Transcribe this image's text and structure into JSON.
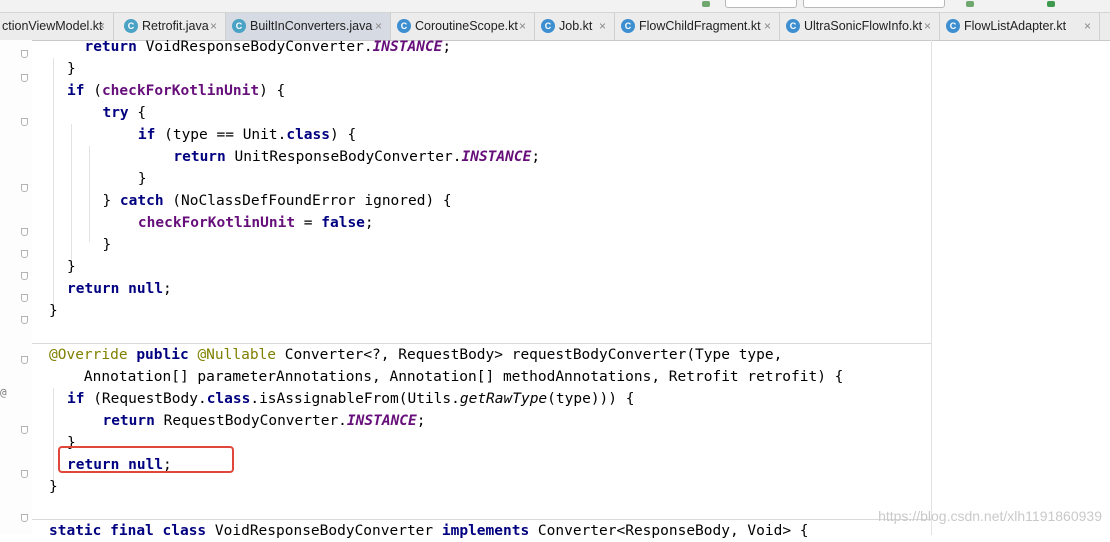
{
  "tabs": [
    {
      "label": "ctionViewModel.kt",
      "icon": "kotlin-file-icon"
    },
    {
      "label": "Retrofit.java",
      "icon": "java-class-icon"
    },
    {
      "label": "BuiltInConverters.java",
      "icon": "java-class-icon",
      "active": true
    },
    {
      "label": "CoroutineScope.kt",
      "icon": "kotlin-file-icon"
    },
    {
      "label": "Job.kt",
      "icon": "kotlin-file-icon"
    },
    {
      "label": "FlowChildFragment.kt",
      "icon": "kotlin-class-icon"
    },
    {
      "label": "UltraSonicFlowInfo.kt",
      "icon": "kotlin-class-icon"
    },
    {
      "label": "FlowListAdapter.kt",
      "icon": "kotlin-class-icon"
    }
  ],
  "close_glyph": "×",
  "gutter_marker": "@",
  "code_lines": [
    [
      {
        "t": "  "
      },
      {
        "t": "return",
        "c": "kw"
      },
      {
        "t": " VoidResponseBodyConverter."
      },
      {
        "t": "INSTANCE",
        "c": "it"
      },
      {
        "t": ";"
      }
    ],
    [
      {
        "t": "}"
      }
    ],
    [
      {
        "t": "if",
        "c": "kw"
      },
      {
        "t": " ("
      },
      {
        "t": "checkForKotlinUnit",
        "c": "fld"
      },
      {
        "t": ") {"
      }
    ],
    [
      {
        "t": "  "
      },
      {
        "t": "try",
        "c": "kw"
      },
      {
        "t": " {"
      }
    ],
    [
      {
        "t": "    "
      },
      {
        "t": "if",
        "c": "kw"
      },
      {
        "t": " (type == Unit."
      },
      {
        "t": "class",
        "c": "kw"
      },
      {
        "t": ") {"
      }
    ],
    [
      {
        "t": "      "
      },
      {
        "t": "return",
        "c": "kw"
      },
      {
        "t": " UnitResponseBodyConverter."
      },
      {
        "t": "INSTANCE",
        "c": "it"
      },
      {
        "t": ";"
      }
    ],
    [
      {
        "t": "    }"
      }
    ],
    [
      {
        "t": "  } "
      },
      {
        "t": "catch",
        "c": "kw"
      },
      {
        "t": " (NoClassDefFoundError ignored) {"
      }
    ],
    [
      {
        "t": "    "
      },
      {
        "t": "checkForKotlinUnit",
        "c": "fld"
      },
      {
        "t": " = "
      },
      {
        "t": "false",
        "c": "kw"
      },
      {
        "t": ";"
      }
    ],
    [
      {
        "t": "  }"
      }
    ],
    [
      {
        "t": "}"
      }
    ],
    [
      {
        "t": "return",
        "c": "kw"
      },
      {
        "t": " "
      },
      {
        "t": "null",
        "c": "kw"
      },
      {
        "t": ";"
      }
    ],
    [
      {
        "t": "}"
      }
    ],
    [
      {
        "t": ""
      }
    ],
    [
      {
        "t": "@Override",
        "c": "an"
      },
      {
        "t": " "
      },
      {
        "t": "public",
        "c": "kw"
      },
      {
        "t": " "
      },
      {
        "t": "@Nullable",
        "c": "an"
      },
      {
        "t": " Converter<?, RequestBody> requestBodyConverter(Type type,"
      }
    ],
    [
      {
        "t": "    Annotation[] parameterAnnotations, Annotation[] methodAnnotations, Retrofit retrofit) {"
      }
    ],
    [
      {
        "t": "if",
        "c": "kw"
      },
      {
        "t": " (RequestBody."
      },
      {
        "t": "class",
        "c": "kw"
      },
      {
        "t": ".isAssignableFrom(Utils."
      },
      {
        "t": "getRawType",
        "c": "mi"
      },
      {
        "t": "(type))) {"
      }
    ],
    [
      {
        "t": "  "
      },
      {
        "t": "return",
        "c": "kw"
      },
      {
        "t": " RequestBodyConverter."
      },
      {
        "t": "INSTANCE",
        "c": "it"
      },
      {
        "t": ";"
      }
    ],
    [
      {
        "t": "}"
      }
    ],
    [
      {
        "t": "return",
        "c": "kw"
      },
      {
        "t": " "
      },
      {
        "t": "null",
        "c": "kw"
      },
      {
        "t": ";"
      }
    ],
    [
      {
        "t": "}"
      }
    ],
    [
      {
        "t": ""
      }
    ],
    [
      {
        "t": "static",
        "c": "kw"
      },
      {
        "t": " "
      },
      {
        "t": "final",
        "c": "kw"
      },
      {
        "t": " "
      },
      {
        "t": "class",
        "c": "kw"
      },
      {
        "t": " VoidResponseBodyConverter "
      },
      {
        "t": "implements",
        "c": "kw"
      },
      {
        "t": " Converter<ResponseBody, Void> {"
      }
    ]
  ],
  "watermark": "https://blog.csdn.net/xlh1191860939",
  "colors": {
    "highlight_box": "#e0473a",
    "keyword": "#000080",
    "field": "#660e7a",
    "annotation": "#808000"
  }
}
